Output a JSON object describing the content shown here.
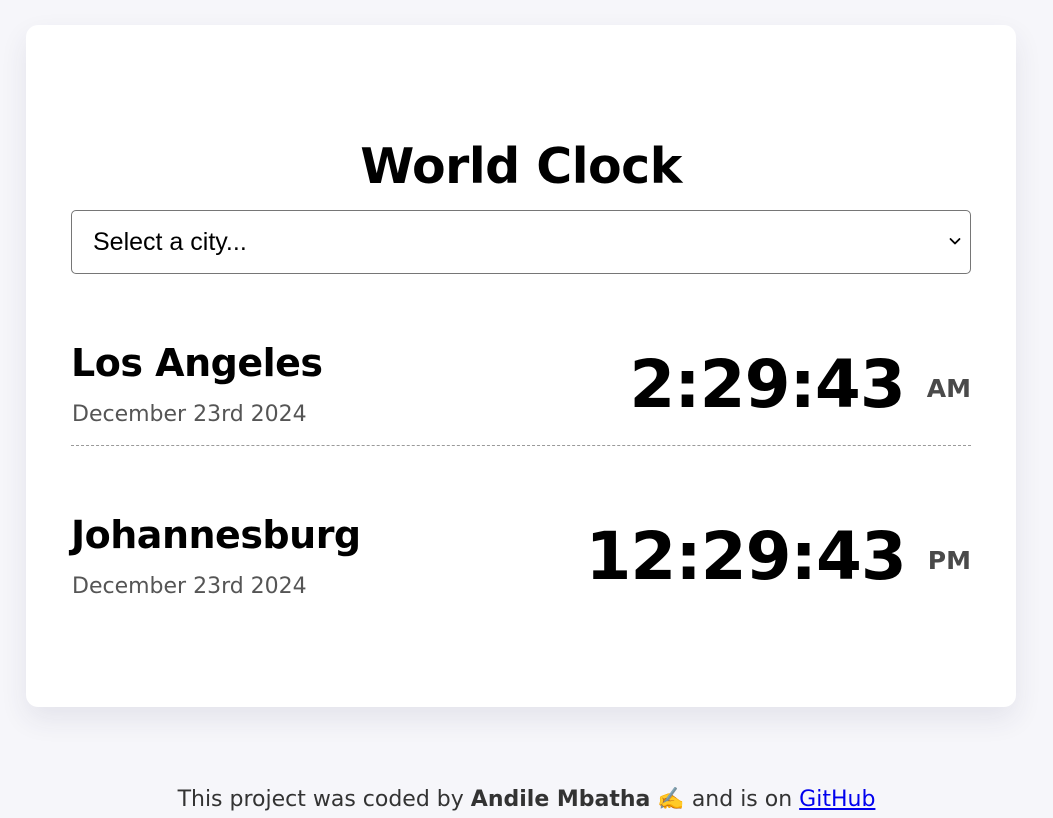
{
  "title": "World Clock",
  "select": {
    "value": "Select a city..."
  },
  "cities": [
    {
      "name": "Los Angeles",
      "date": "December 23rd 2024",
      "time": "2:29:43",
      "period": "AM"
    },
    {
      "name": "Johannesburg",
      "date": "December 23rd 2024",
      "time": "12:29:43",
      "period": "PM"
    }
  ],
  "footer": {
    "prefix": "This project was coded by",
    "author": "Andile Mbatha",
    "emoji": "✍️",
    "middle": "and is on",
    "link_text": "GitHub"
  },
  "colors": {
    "background": "#f6f6fa",
    "card": "#ffffff",
    "link": "#0000ee"
  }
}
